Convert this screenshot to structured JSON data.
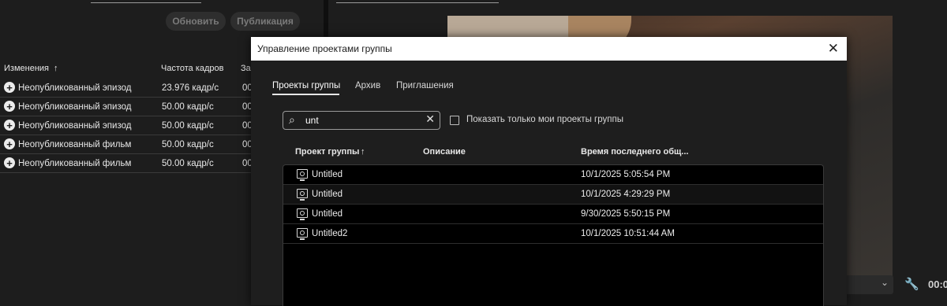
{
  "left_panel": {
    "buttons": {
      "refresh": "Обновить",
      "publish": "Публикация"
    },
    "columns": {
      "changes": "Изменения",
      "sort_arrow": "↑",
      "frame_rate": "Частота кадров",
      "extra": "За"
    },
    "rows": [
      {
        "name": "Неопубликованный эпизод",
        "rate": "23.976 кадр/с",
        "extra": "00"
      },
      {
        "name": "Неопубликованный эпизод",
        "rate": "50.00 кадр/с",
        "extra": "00"
      },
      {
        "name": "Неопубликованный эпизод",
        "rate": "50.00 кадр/с",
        "extra": "00"
      },
      {
        "name": "Неопубликованный фильм",
        "rate": "50.00 кадр/с",
        "extra": "00"
      },
      {
        "name": "Неопубликованный фильм",
        "rate": "50.00 кадр/с",
        "extra": "00"
      }
    ]
  },
  "right_panel": {
    "time": "00:0"
  },
  "dialog": {
    "title": "Управление проектами группы",
    "close_glyph": "✕",
    "tabs": [
      "Проекты группы",
      "Архив",
      "Приглашения"
    ],
    "search": {
      "value": "unt",
      "clear_glyph": "✕",
      "icon_glyph": "⌕"
    },
    "filter_label": "Показать только мои проекты группы",
    "columns": {
      "project": "Проект группы",
      "sort_arrow": "↑",
      "description": "Описание",
      "last_access": "Время последнего общ..."
    },
    "rows": [
      {
        "name": "Untitled",
        "time": "10/1/2025 5:05:54 PM"
      },
      {
        "name": "Untitled",
        "time": "10/1/2025 4:29:29 PM"
      },
      {
        "name": "Untitled",
        "time": "9/30/2025 5:50:15 PM"
      },
      {
        "name": "Untitled2",
        "time": "10/1/2025 10:51:44 AM"
      }
    ]
  },
  "icons": {
    "plus": "plus-circle-icon",
    "close": "close-icon",
    "search": "search-icon",
    "project": "team-project-icon",
    "wrench": "wrench-icon",
    "chevron": "chevron-down-icon"
  },
  "colors": {
    "background": "#1d1d1d",
    "dialog_bg": "#1e1e1e",
    "titlebar": "#ffffff",
    "table_bg": "#000000"
  }
}
